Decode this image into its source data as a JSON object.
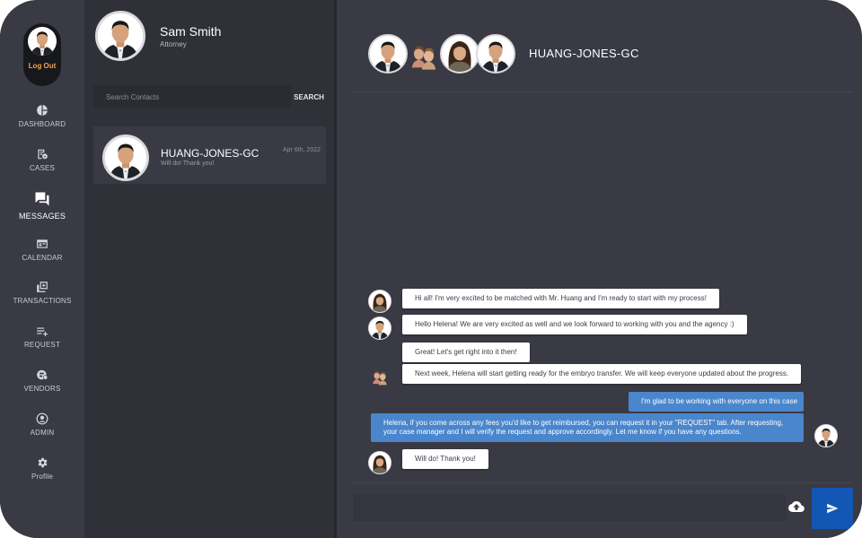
{
  "sidebar": {
    "logout_label": "Log Out",
    "items": [
      {
        "label": "DASHBOARD",
        "icon": "pie-chart-icon"
      },
      {
        "label": "CASES",
        "icon": "cases-icon"
      },
      {
        "label": "MESSAGES",
        "icon": "chat-bubbles-icon",
        "active": true
      },
      {
        "label": "CALENDAR",
        "icon": "calendar-icon"
      },
      {
        "label": "TRANSACTIONS",
        "icon": "transactions-icon"
      },
      {
        "label": "REQUEST",
        "icon": "playlist-add-icon"
      },
      {
        "label": "VENDORS",
        "icon": "vendors-icon"
      },
      {
        "label": "ADMIN",
        "icon": "account-circle-icon"
      },
      {
        "label": "Profile",
        "icon": "gear-icon"
      }
    ]
  },
  "user": {
    "name": "Sam Smith",
    "role": "Attorney"
  },
  "search": {
    "placeholder": "Search Contacts",
    "button_label": "SEARCH"
  },
  "contacts": [
    {
      "name": "HUANG-JONES-GC",
      "preview": "Will do! Thank you!",
      "date": "Apr 6th, 2022"
    }
  ],
  "chat": {
    "title": "HUANG-JONES-GC",
    "messages": [
      {
        "text": "Hi all! I'm very excited to be matched with Mr. Huang and I'm ready to start with my process!",
        "direction": "in",
        "sender": "woman-avatar"
      },
      {
        "text": "Hello Helena! We are very excited as well and we look forward to working with you and the agency :)",
        "direction": "in",
        "sender": "man-avatar"
      },
      {
        "text": "Great! Let's get right into it then!",
        "direction": "in",
        "sender": "none"
      },
      {
        "text": "Next week, Helena will start getting ready for the embryo transfer. We will keep everyone updated about the progress.",
        "direction": "in",
        "sender": "couple-avatar"
      },
      {
        "text": "I'm glad to be working with everyone on this case",
        "direction": "out",
        "sender": "none"
      },
      {
        "text": "Helena, if you come across any fees you'd like to get reimbursed, you can request it in your \"REQUEST\" tab. After requesting, your case manager and I will verify the request and approve accordingly. Let me know if you have any questions.",
        "direction": "out",
        "sender": "me-avatar"
      },
      {
        "text": "Will do! Thank you!",
        "direction": "in",
        "sender": "woman-avatar"
      }
    ]
  },
  "compose": {
    "placeholder": ""
  },
  "colors": {
    "frame_bg": "#393a44",
    "contacts_bg": "#2f3038",
    "logout_accent": "#f4a24e",
    "outgoing_bubble": "#4a86cc",
    "send_button": "#1357b4"
  }
}
